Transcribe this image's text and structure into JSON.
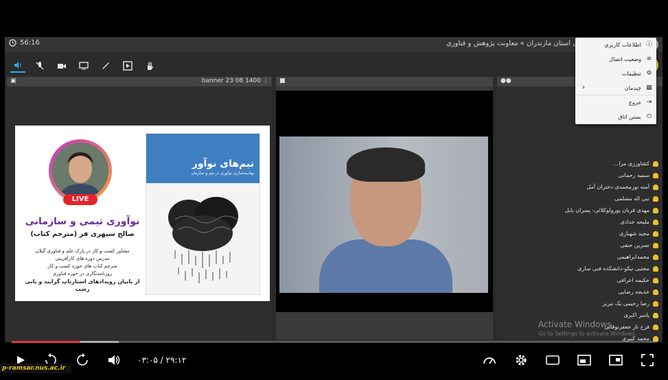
{
  "titlebar": {
    "timer": "56:16",
    "breadcrumb": "دانشگاه فنی و حرفه ای استان مازندران » معاونت پژوهش و فناوری"
  },
  "share_pod": {
    "title": "banner 23 08 1400",
    "book_title": "تیم‌های نوآور",
    "book_subtitle": "نهادینه‌سازی نوآوری در تیم و سازمان",
    "live_badge": "LIVE",
    "talk_title": "نوآوری تیمی و سازمانی",
    "speaker": "صالح سپهری فر (مترجم کتاب)",
    "bio_lines": [
      "مشاور کسب و کار در پارک علم و فناوری گیلان",
      "مدرس دوره های کارآفرینی",
      "مترجم کتاب های حوزه کسب و کار",
      "روزنامه‌نگاری در حوزه فناوری",
      "از بانیان رویدادهای استارتاپ گرایند و بانی رشت"
    ]
  },
  "attendees": [
    "کشاورزی مزا...",
    "سمیه رحمانی",
    "آمنه نورمحمدی دختران آمل",
    "نبی اله مسلمی",
    "مهدی قربان پورولوکلائی- پسران بابل",
    "ملیحه حدادی",
    "مجید شهبازی",
    "نسرین حنفی",
    "محمدابراهیمی",
    "مجتبی نیکو-دانشکده فنی ساری",
    "حکیمه اعرافی",
    "خدیجه رضایی",
    "رضا رحیمی یک تبریز",
    "یاسر اکبری",
    "فرخ ناز جعفرنوقابی",
    "محمد کبیری"
  ],
  "watermark": {
    "line1": "Activate Windows",
    "line2": "Go to Settings to activate Windows."
  },
  "menu": {
    "items": [
      {
        "label": "اطلاعات کاربری",
        "icon": "info-icon"
      },
      {
        "label": "وضعیت اتصال",
        "icon": "wifi-icon"
      },
      {
        "label": "تنظیمات",
        "icon": "gear-icon"
      },
      {
        "label": "چیدمان",
        "icon": "layout-icon"
      },
      {
        "label": "خروج",
        "icon": "exit-icon"
      },
      {
        "label": "بستن اتاق",
        "icon": "power-icon"
      }
    ]
  },
  "player": {
    "time": "۰۳:۰۵ / ۲۹:۱۲",
    "progress_fraction": 0.106,
    "brand": "p-ramsar.nus.ac.ir"
  },
  "colors": {
    "accent": "#3aa7f2",
    "menu_button": "#e9d23a",
    "progress": "#e53935",
    "attendee_icon": "#e8c22a"
  }
}
